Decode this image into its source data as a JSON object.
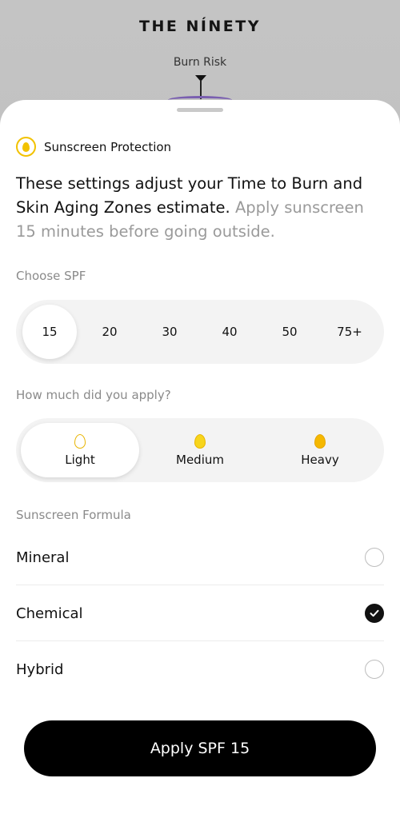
{
  "header": {
    "logo": "THE NÍNETY",
    "burn_risk_label": "Burn Risk"
  },
  "sheet": {
    "section_title": "Sunscreen Protection",
    "description_main": "These settings adjust your Time to Burn and Skin Aging Zones estimate.",
    "description_muted": "Apply sunscreen 15 minutes before going outside.",
    "spf_label": "Choose SPF",
    "spf_options": [
      "15",
      "20",
      "30",
      "40",
      "50",
      "75+"
    ],
    "spf_selected": "15",
    "amount_label": "How much did you apply?",
    "amount_options": [
      "Light",
      "Medium",
      "Heavy"
    ],
    "amount_selected": "Light",
    "formula_label": "Sunscreen Formula",
    "formulas": [
      "Mineral",
      "Chemical",
      "Hybrid"
    ],
    "formula_selected": "Chemical",
    "apply_button": "Apply SPF 15"
  },
  "colors": {
    "accent_yellow": "#f2c200",
    "button_bg": "#000000",
    "muted_text": "#9a9a9a"
  }
}
